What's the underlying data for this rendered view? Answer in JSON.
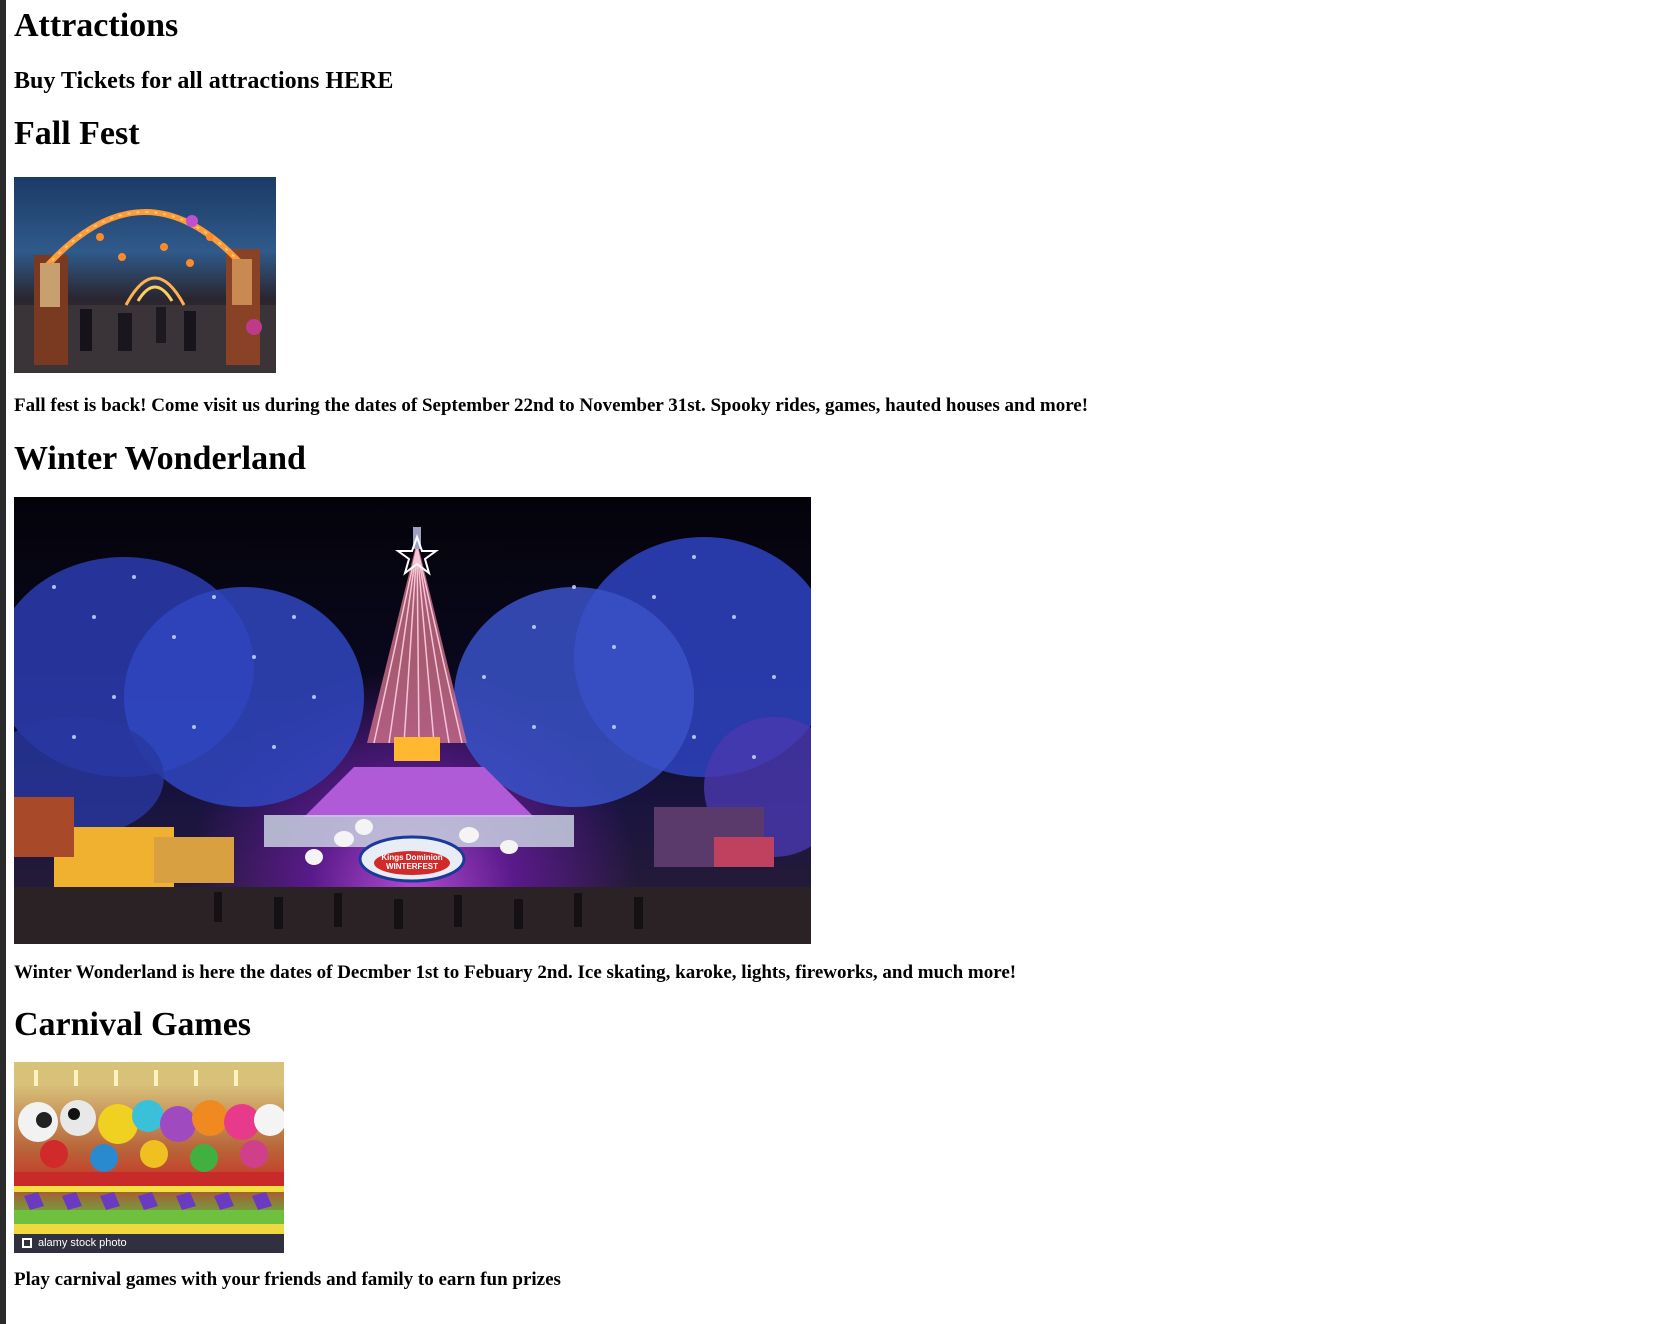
{
  "page": {
    "title": "Attractions",
    "tickets_link": "Buy Tickets for all attractions HERE"
  },
  "sections": [
    {
      "title": "Fall Fest",
      "image_icon": "fall-fest-photo",
      "description": "Fall fest is back! Come visit us during the dates of September 22nd to November 31st. Spooky rides, games, hauted houses and more!"
    },
    {
      "title": "Winter Wonderland",
      "image_icon": "winter-wonderland-photo",
      "sign_text": "Kings Dominion WINTERFEST",
      "description": "Winter Wonderland is here the dates of Decmber 1st to Febuary 2nd. Ice skating, karoke, lights, fireworks, and much more!"
    },
    {
      "title": "Carnival Games",
      "image_icon": "carnival-games-photo",
      "watermark": "alamy stock photo",
      "description": "Play carnival games with your friends and family to earn fun prizes"
    }
  ]
}
